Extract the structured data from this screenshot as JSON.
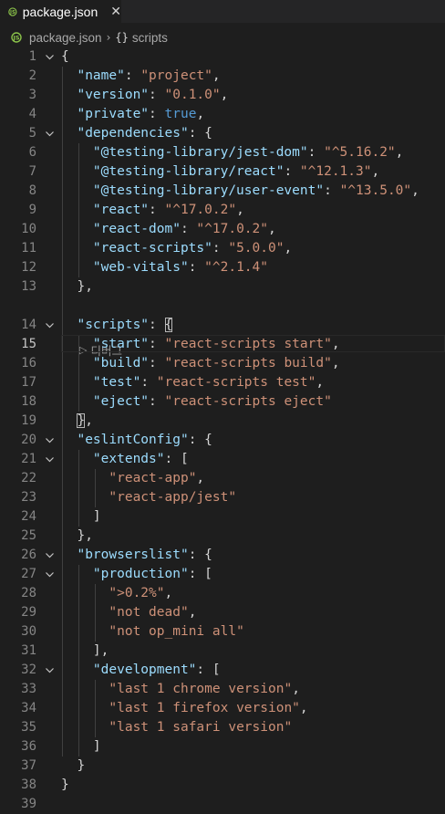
{
  "tab": {
    "label": "package.json",
    "close_glyph": "✕",
    "icon": "js-file-icon"
  },
  "breadcrumb": {
    "file": "package.json",
    "separator": "›",
    "symbol": "scripts",
    "symbol_icon": "{}"
  },
  "codelens": {
    "label": "디버그"
  },
  "colors": {
    "key": "#9cdcfe",
    "string": "#ce9178",
    "boolean": "#569cd6",
    "punct": "#d4d4d4"
  },
  "lines": [
    {
      "n": "1",
      "tokens": [
        [
          "p",
          "{"
        ]
      ]
    },
    {
      "n": "2",
      "tokens": [
        [
          "p",
          "  "
        ],
        [
          "k",
          "\"name\""
        ],
        [
          "p",
          ": "
        ],
        [
          "s",
          "\"project\""
        ],
        [
          "p",
          ","
        ]
      ]
    },
    {
      "n": "3",
      "tokens": [
        [
          "p",
          "  "
        ],
        [
          "k",
          "\"version\""
        ],
        [
          "p",
          ": "
        ],
        [
          "s",
          "\"0.1.0\""
        ],
        [
          "p",
          ","
        ]
      ]
    },
    {
      "n": "4",
      "tokens": [
        [
          "p",
          "  "
        ],
        [
          "k",
          "\"private\""
        ],
        [
          "p",
          ": "
        ],
        [
          "b",
          "true"
        ],
        [
          "p",
          ","
        ]
      ]
    },
    {
      "n": "5",
      "tokens": [
        [
          "p",
          "  "
        ],
        [
          "k",
          "\"dependencies\""
        ],
        [
          "p",
          ": {"
        ]
      ]
    },
    {
      "n": "6",
      "tokens": [
        [
          "p",
          "    "
        ],
        [
          "k",
          "\"@testing-library/jest-dom\""
        ],
        [
          "p",
          ": "
        ],
        [
          "s",
          "\"^5.16.2\""
        ],
        [
          "p",
          ","
        ]
      ]
    },
    {
      "n": "7",
      "tokens": [
        [
          "p",
          "    "
        ],
        [
          "k",
          "\"@testing-library/react\""
        ],
        [
          "p",
          ": "
        ],
        [
          "s",
          "\"^12.1.3\""
        ],
        [
          "p",
          ","
        ]
      ]
    },
    {
      "n": "8",
      "tokens": [
        [
          "p",
          "    "
        ],
        [
          "k",
          "\"@testing-library/user-event\""
        ],
        [
          "p",
          ": "
        ],
        [
          "s",
          "\"^13.5.0\""
        ],
        [
          "p",
          ","
        ]
      ]
    },
    {
      "n": "9",
      "tokens": [
        [
          "p",
          "    "
        ],
        [
          "k",
          "\"react\""
        ],
        [
          "p",
          ": "
        ],
        [
          "s",
          "\"^17.0.2\""
        ],
        [
          "p",
          ","
        ]
      ]
    },
    {
      "n": "10",
      "tokens": [
        [
          "p",
          "    "
        ],
        [
          "k",
          "\"react-dom\""
        ],
        [
          "p",
          ": "
        ],
        [
          "s",
          "\"^17.0.2\""
        ],
        [
          "p",
          ","
        ]
      ]
    },
    {
      "n": "11",
      "tokens": [
        [
          "p",
          "    "
        ],
        [
          "k",
          "\"react-scripts\""
        ],
        [
          "p",
          ": "
        ],
        [
          "s",
          "\"5.0.0\""
        ],
        [
          "p",
          ","
        ]
      ]
    },
    {
      "n": "12",
      "tokens": [
        [
          "p",
          "    "
        ],
        [
          "k",
          "\"web-vitals\""
        ],
        [
          "p",
          ": "
        ],
        [
          "s",
          "\"^2.1.4\""
        ]
      ]
    },
    {
      "n": "13",
      "tokens": [
        [
          "p",
          "  },"
        ]
      ]
    },
    {
      "n": "14",
      "tokens": [
        [
          "p",
          "  "
        ],
        [
          "k",
          "\"scripts\""
        ],
        [
          "p",
          ": "
        ],
        [
          "pm",
          "{"
        ]
      ]
    },
    {
      "n": "15",
      "tokens": [
        [
          "p",
          "    "
        ],
        [
          "k",
          "\"start\""
        ],
        [
          "p",
          ": "
        ],
        [
          "s",
          "\"react-scripts start\""
        ],
        [
          "p",
          ","
        ]
      ]
    },
    {
      "n": "16",
      "tokens": [
        [
          "p",
          "    "
        ],
        [
          "k",
          "\"build\""
        ],
        [
          "p",
          ": "
        ],
        [
          "s",
          "\"react-scripts build\""
        ],
        [
          "p",
          ","
        ]
      ]
    },
    {
      "n": "17",
      "tokens": [
        [
          "p",
          "    "
        ],
        [
          "k",
          "\"test\""
        ],
        [
          "p",
          ": "
        ],
        [
          "s",
          "\"react-scripts test\""
        ],
        [
          "p",
          ","
        ]
      ]
    },
    {
      "n": "18",
      "tokens": [
        [
          "p",
          "    "
        ],
        [
          "k",
          "\"eject\""
        ],
        [
          "p",
          ": "
        ],
        [
          "s",
          "\"react-scripts eject\""
        ]
      ]
    },
    {
      "n": "19",
      "tokens": [
        [
          "p",
          "  "
        ],
        [
          "pm",
          "}"
        ],
        [
          "p",
          ","
        ]
      ]
    },
    {
      "n": "20",
      "tokens": [
        [
          "p",
          "  "
        ],
        [
          "k",
          "\"eslintConfig\""
        ],
        [
          "p",
          ": {"
        ]
      ]
    },
    {
      "n": "21",
      "tokens": [
        [
          "p",
          "    "
        ],
        [
          "k",
          "\"extends\""
        ],
        [
          "p",
          ": ["
        ]
      ]
    },
    {
      "n": "22",
      "tokens": [
        [
          "p",
          "      "
        ],
        [
          "s",
          "\"react-app\""
        ],
        [
          "p",
          ","
        ]
      ]
    },
    {
      "n": "23",
      "tokens": [
        [
          "p",
          "      "
        ],
        [
          "s",
          "\"react-app/jest\""
        ]
      ]
    },
    {
      "n": "24",
      "tokens": [
        [
          "p",
          "    ]"
        ]
      ]
    },
    {
      "n": "25",
      "tokens": [
        [
          "p",
          "  },"
        ]
      ]
    },
    {
      "n": "26",
      "tokens": [
        [
          "p",
          "  "
        ],
        [
          "k",
          "\"browserslist\""
        ],
        [
          "p",
          ": {"
        ]
      ]
    },
    {
      "n": "27",
      "tokens": [
        [
          "p",
          "    "
        ],
        [
          "k",
          "\"production\""
        ],
        [
          "p",
          ": ["
        ]
      ]
    },
    {
      "n": "28",
      "tokens": [
        [
          "p",
          "      "
        ],
        [
          "s",
          "\">0.2%\""
        ],
        [
          "p",
          ","
        ]
      ]
    },
    {
      "n": "29",
      "tokens": [
        [
          "p",
          "      "
        ],
        [
          "s",
          "\"not dead\""
        ],
        [
          "p",
          ","
        ]
      ]
    },
    {
      "n": "30",
      "tokens": [
        [
          "p",
          "      "
        ],
        [
          "s",
          "\"not op_mini all\""
        ]
      ]
    },
    {
      "n": "31",
      "tokens": [
        [
          "p",
          "    ],"
        ]
      ]
    },
    {
      "n": "32",
      "tokens": [
        [
          "p",
          "    "
        ],
        [
          "k",
          "\"development\""
        ],
        [
          "p",
          ": ["
        ]
      ]
    },
    {
      "n": "33",
      "tokens": [
        [
          "p",
          "      "
        ],
        [
          "s",
          "\"last 1 chrome version\""
        ],
        [
          "p",
          ","
        ]
      ]
    },
    {
      "n": "34",
      "tokens": [
        [
          "p",
          "      "
        ],
        [
          "s",
          "\"last 1 firefox version\""
        ],
        [
          "p",
          ","
        ]
      ]
    },
    {
      "n": "35",
      "tokens": [
        [
          "p",
          "      "
        ],
        [
          "s",
          "\"last 1 safari version\""
        ]
      ]
    },
    {
      "n": "36",
      "tokens": [
        [
          "p",
          "    ]"
        ]
      ]
    },
    {
      "n": "37",
      "tokens": [
        [
          "p",
          "  }"
        ]
      ]
    },
    {
      "n": "38",
      "tokens": [
        [
          "p",
          "}"
        ]
      ]
    },
    {
      "n": "39",
      "tokens": []
    }
  ],
  "folds": [
    "1",
    "5",
    "14",
    "20",
    "21",
    "26",
    "27",
    "32"
  ],
  "current_line": "15"
}
